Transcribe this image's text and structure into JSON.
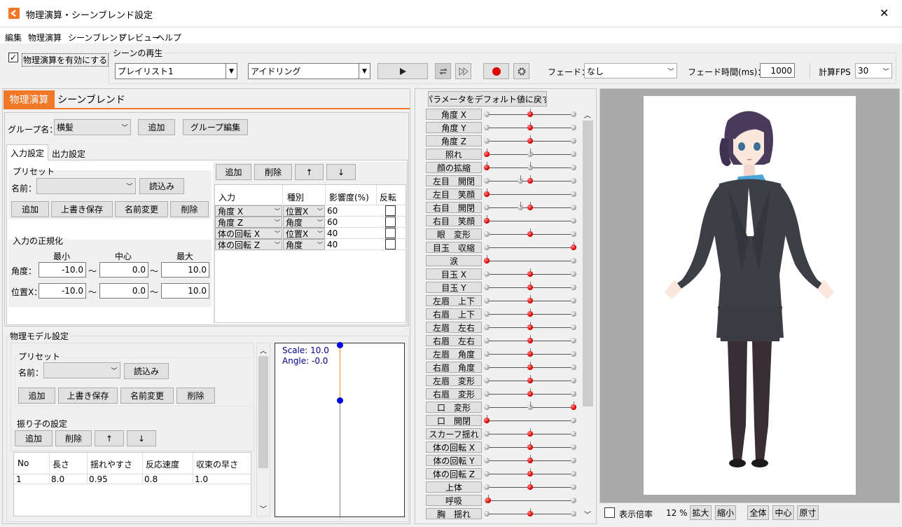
{
  "window": {
    "title": "物理演算・シーンブレンド設定",
    "close_glyph": "✕"
  },
  "menu": [
    "編集",
    "物理演算",
    "シーンブレンド",
    "プレビュー",
    "ヘルプ"
  ],
  "toolbar": {
    "enable_physics_label": "物理演算を有効にする",
    "enable_physics_checked": true,
    "scene_play_title": "シーンの再生",
    "playlist_value": "プレイリスト1",
    "scene_value": "アイドリング",
    "fade_label": "フェード：",
    "fade_value": "なし",
    "fade_time_label": "フェード時間(ms)：",
    "fade_time_value": "1000",
    "fps_label": "計算FPS",
    "fps_value": "30"
  },
  "left": {
    "tabs": [
      "物理演算",
      "シーンブレンド"
    ],
    "group_label": "グループ名：",
    "group_value": "横髪",
    "add_label": "追加",
    "group_edit_label": "グループ編集",
    "subtabs": [
      "入力設定",
      "出力設定"
    ],
    "preset_title": "プリセット",
    "name_label": "名前：",
    "load_label": "読込み",
    "preset_buttons": [
      "追加",
      "上書き保存",
      "名前変更",
      "削除"
    ],
    "normalize_title": "入力の正規化",
    "normalize_headers": [
      "最小",
      "中心",
      "最大"
    ],
    "normalize_rows": [
      {
        "label": "角度：",
        "min": "-10.0",
        "center": "0.0",
        "max": "10.0"
      },
      {
        "label": "位置X：",
        "min": "-10.0",
        "center": "0.0",
        "max": "10.0"
      }
    ],
    "tilde": "～",
    "input_buttons": [
      "追加",
      "削除",
      "↑",
      "↓"
    ],
    "input_headers": [
      "入力",
      "種別",
      "影響度(%)",
      "反転"
    ],
    "input_rows": [
      {
        "input": "角度 X",
        "type": "位置X",
        "weight": "60"
      },
      {
        "input": "角度 Z",
        "type": "角度",
        "weight": "60"
      },
      {
        "input": "体の回転 X",
        "type": "位置X",
        "weight": "40"
      },
      {
        "input": "体の回転 Z",
        "type": "角度",
        "weight": "40"
      }
    ]
  },
  "model": {
    "title": "物理モデル設定",
    "preset_title": "プリセット",
    "name_label": "名前：",
    "load_label": "読込み",
    "preset_buttons": [
      "追加",
      "上書き保存",
      "名前変更",
      "削除"
    ],
    "pendulum_title": "振り子の設定",
    "pendulum_buttons": [
      "追加",
      "削除",
      "↑",
      "↓"
    ],
    "pendulum_headers": [
      "No",
      "長さ",
      "揺れやすさ",
      "反応速度",
      "収束の早さ"
    ],
    "pendulum_rows": [
      [
        "1",
        "8.0",
        "0.95",
        "0.8",
        "1.0"
      ]
    ],
    "scale_text": "Scale: 10.0",
    "angle_text": "Angle: -0.0"
  },
  "params": {
    "reset_label": "パラメータをデフォルト値に戻す",
    "items": [
      {
        "label": "角度 X",
        "value": 0.5,
        "marker": null
      },
      {
        "label": "角度 Y",
        "value": 0.5,
        "marker": null
      },
      {
        "label": "角度 Z",
        "value": 0.5,
        "marker": null
      },
      {
        "label": "照れ",
        "value": 0.0,
        "marker": 0.5
      },
      {
        "label": "顔の拡縮",
        "value": 0.0,
        "marker": 0.5
      },
      {
        "label": "左目　開閉",
        "value": 0.5,
        "marker": 0.39
      },
      {
        "label": "左目　笑顔",
        "value": 0.0,
        "marker": null
      },
      {
        "label": "右目　開閉",
        "value": 0.5,
        "marker": 0.39
      },
      {
        "label": "右目　笑顔",
        "value": 0.0,
        "marker": null
      },
      {
        "label": "眼　変形",
        "value": 0.5,
        "marker": null
      },
      {
        "label": "目玉　収縮",
        "value": 1.0,
        "marker": null
      },
      {
        "label": "涙",
        "value": 0.0,
        "marker": null
      },
      {
        "label": "目玉 X",
        "value": 0.5,
        "marker": null
      },
      {
        "label": "目玉 Y",
        "value": 0.5,
        "marker": null
      },
      {
        "label": "左眉　上下",
        "value": 0.5,
        "marker": null
      },
      {
        "label": "右眉　上下",
        "value": 0.5,
        "marker": null
      },
      {
        "label": "左眉　左右",
        "value": 0.5,
        "marker": null
      },
      {
        "label": "右眉　左右",
        "value": 0.5,
        "marker": null
      },
      {
        "label": "左眉　角度",
        "value": 0.5,
        "marker": null
      },
      {
        "label": "右眉　角度",
        "value": 0.5,
        "marker": null
      },
      {
        "label": "左眉　変形",
        "value": 0.5,
        "marker": null
      },
      {
        "label": "右眉　変形",
        "value": 0.5,
        "marker": null
      },
      {
        "label": "口　変形",
        "value": 1.0,
        "marker": 0.5
      },
      {
        "label": "口　開閉",
        "value": 0.0,
        "marker": null
      },
      {
        "label": "スカーフ揺れ",
        "value": 0.5,
        "marker": null
      },
      {
        "label": "体の回転 X",
        "value": 0.5,
        "marker": null
      },
      {
        "label": "体の回転 Y",
        "value": 0.5,
        "marker": null
      },
      {
        "label": "体の回転 Z",
        "value": 0.5,
        "marker": null
      },
      {
        "label": "上体",
        "value": 0.5,
        "marker": null
      },
      {
        "label": "呼吸",
        "value": 0.02,
        "marker": null
      },
      {
        "label": "胸　揺れ",
        "value": 0.5,
        "marker": null
      }
    ]
  },
  "preview": {
    "zoom_checkbox_label": "表示倍率",
    "zoom_value": "12 %",
    "buttons": [
      "拡大",
      "縮小",
      "全体",
      "中心",
      "原寸"
    ]
  },
  "colors": {
    "accent": "#f07826",
    "knob_red": "#e00000",
    "pendulum_line": "#f08c1e",
    "pendulum_node": "#0000e0"
  }
}
